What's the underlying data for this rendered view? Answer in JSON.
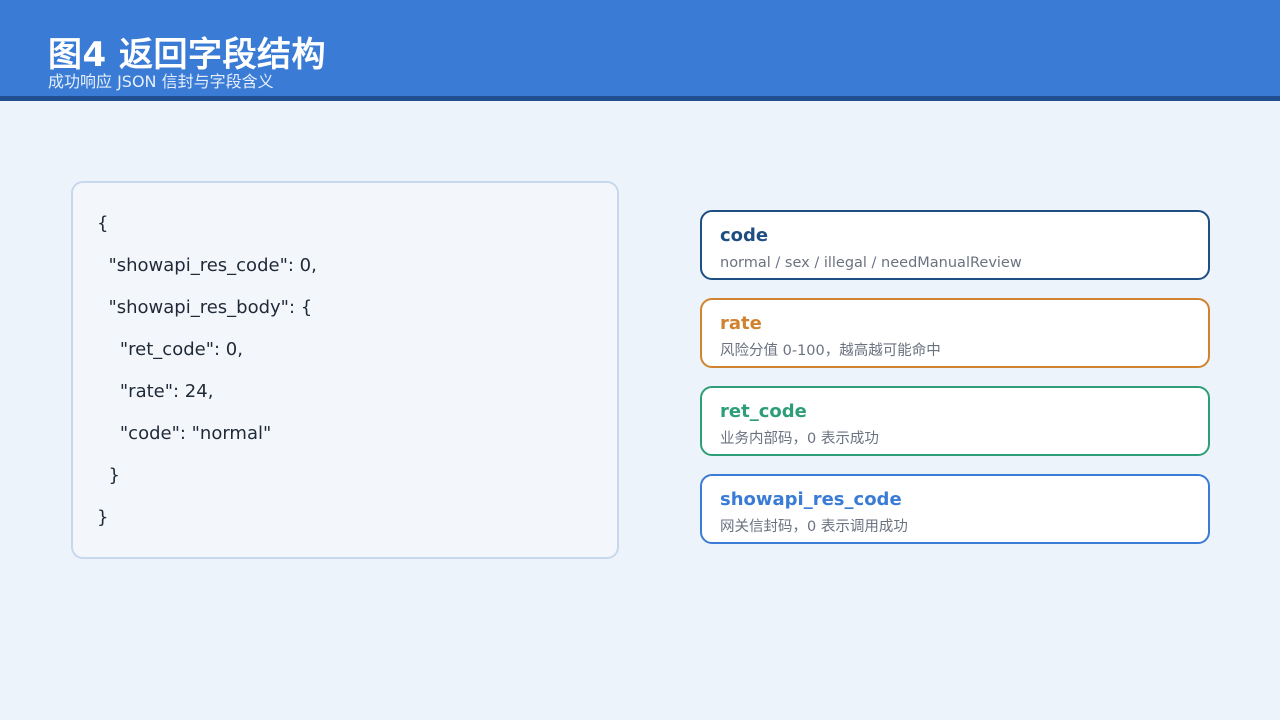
{
  "header": {
    "title": "图4  返回字段结构",
    "subtitle": "成功响应 JSON 信封与字段含义"
  },
  "json_sample": {
    "lines": [
      "{",
      "  \"showapi_res_code\": 0,",
      "  \"showapi_res_body\": {",
      "    \"ret_code\": 0,",
      "    \"rate\": 24,",
      "    \"code\": \"normal\"",
      "  }",
      "}"
    ]
  },
  "fields": [
    {
      "name": "code",
      "description": "normal / sex / illegal / needManualReview",
      "color": "#1f4e82"
    },
    {
      "name": "rate",
      "description": "风险分值 0-100，越高越可能命中",
      "color": "#d0832f"
    },
    {
      "name": "ret_code",
      "description": "业务内部码，0 表示成功",
      "color": "#2e9e78"
    },
    {
      "name": "showapi_res_code",
      "description": "网关信封码，0 表示调用成功",
      "color": "#3a7bd5"
    }
  ]
}
